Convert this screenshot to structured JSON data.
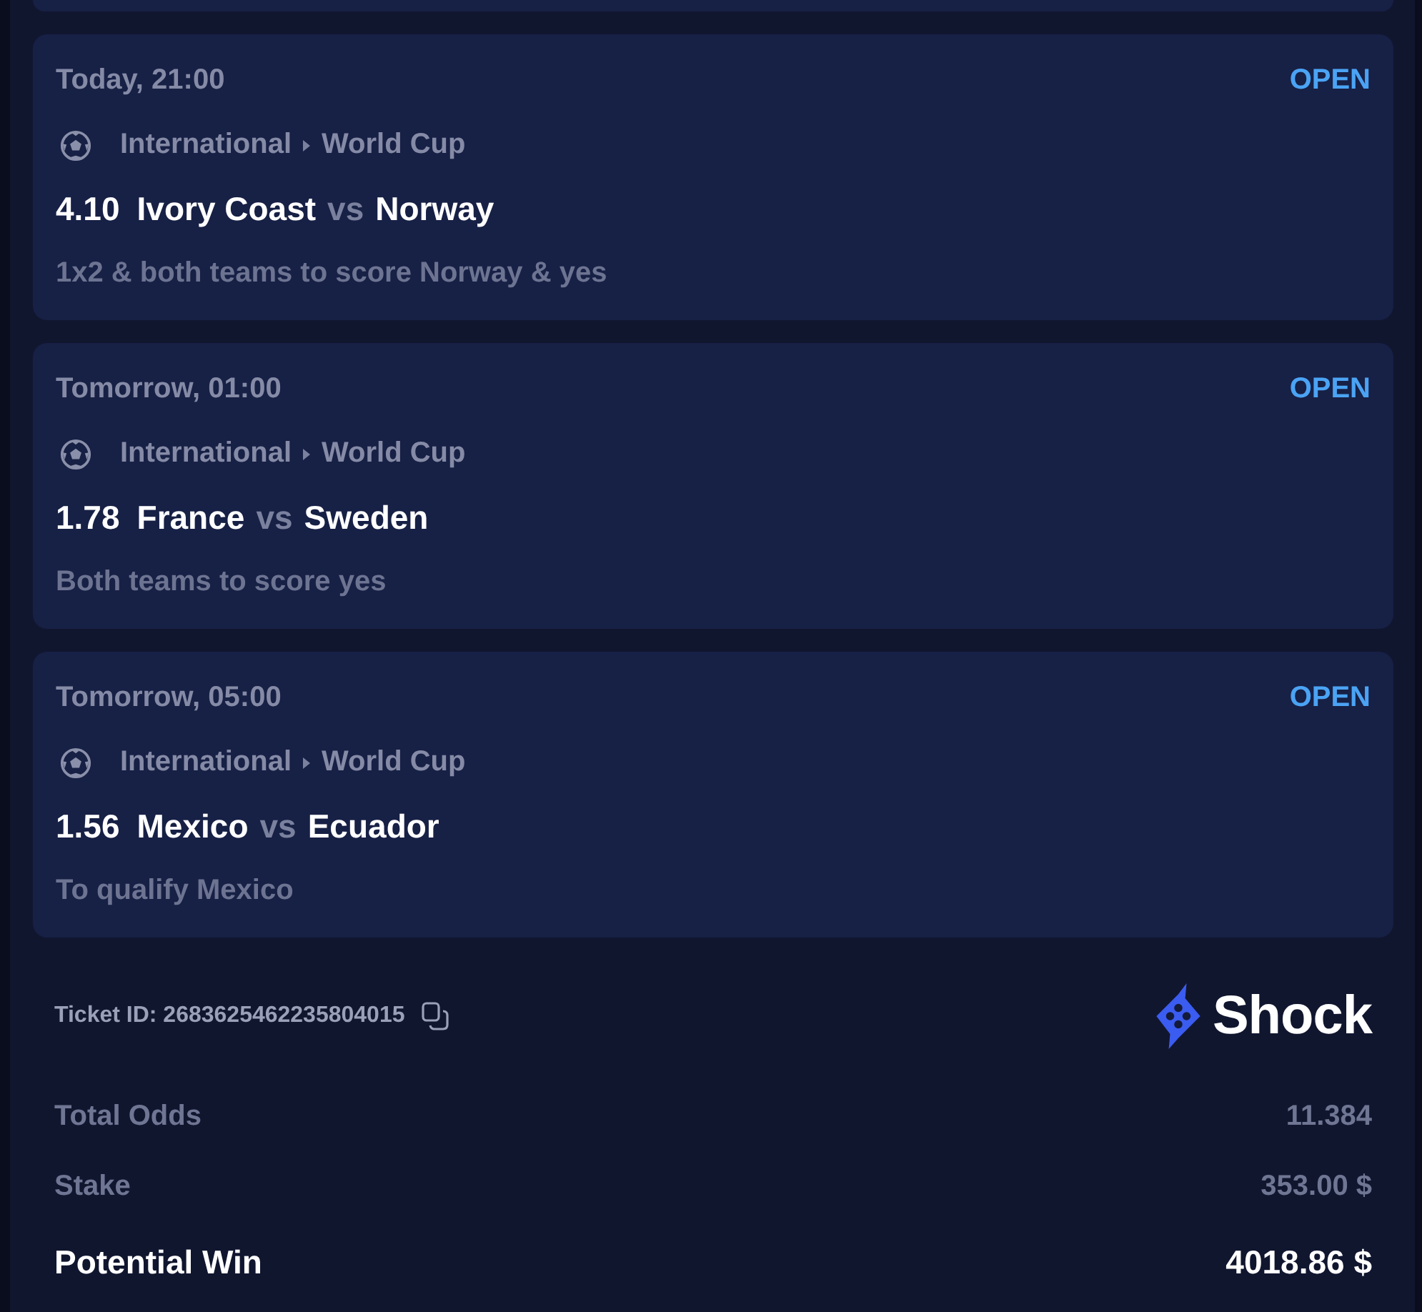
{
  "bets": [
    {
      "time": "Today, 21:00",
      "status": "OPEN",
      "category": "International",
      "league": "World Cup",
      "odds": "4.10",
      "home": "Ivory Coast",
      "versus": "vs",
      "away": "Norway",
      "market": "1x2 & both teams to score Norway & yes"
    },
    {
      "time": "Tomorrow, 01:00",
      "status": "OPEN",
      "category": "International",
      "league": "World Cup",
      "odds": "1.78",
      "home": "France",
      "versus": "vs",
      "away": "Sweden",
      "market": "Both teams to score yes"
    },
    {
      "time": "Tomorrow, 05:00",
      "status": "OPEN",
      "category": "International",
      "league": "World Cup",
      "odds": "1.56",
      "home": "Mexico",
      "versus": "vs",
      "away": "Ecuador",
      "market": "To qualify Mexico"
    }
  ],
  "ticket": {
    "id_text": "Ticket ID: 2683625462235804015"
  },
  "brand": {
    "name": "Shock"
  },
  "summary": [
    {
      "kind": "plain",
      "label": "Total Odds",
      "value": "11.384"
    },
    {
      "kind": "plain",
      "label": "Stake",
      "value": "353.00 $"
    },
    {
      "kind": "total",
      "label": "Potential Win",
      "value": "4018.86 $"
    }
  ]
}
